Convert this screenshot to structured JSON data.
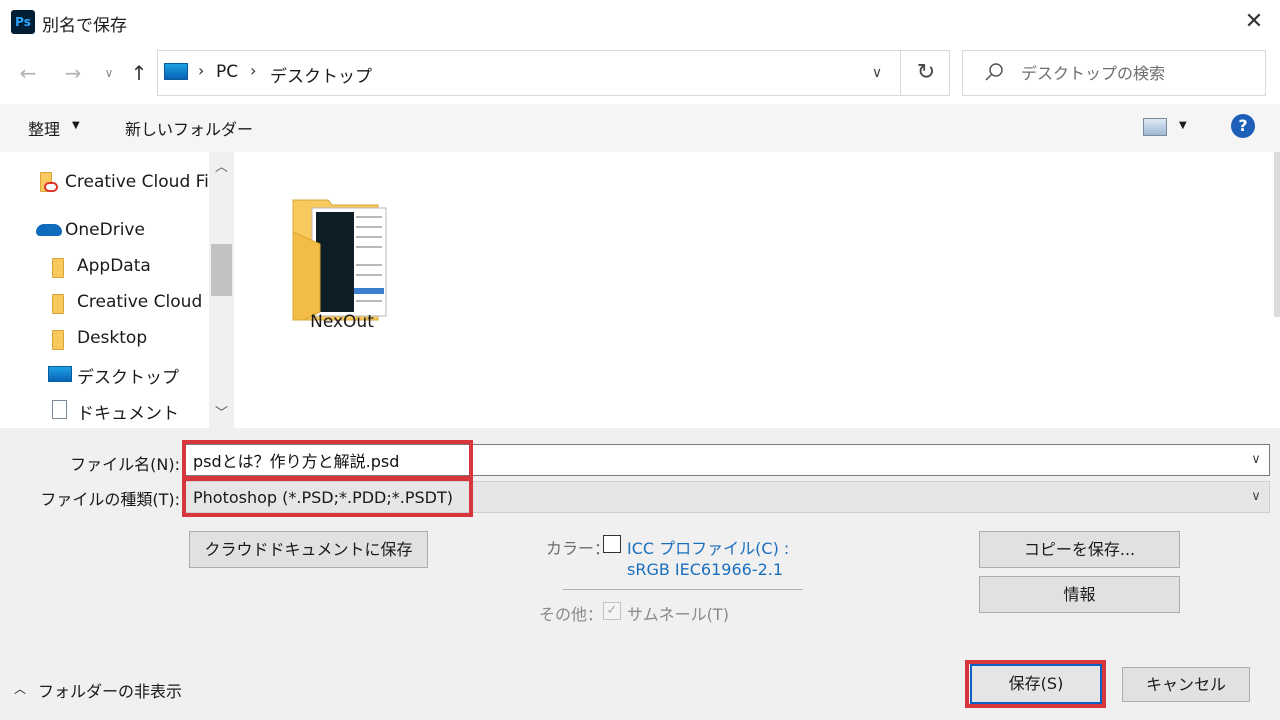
{
  "window": {
    "title": "別名で保存",
    "app_icon_text": "Ps"
  },
  "nav": {
    "back": "←",
    "forward": "→",
    "recent": "∨",
    "up": "↑",
    "breadcrumb": [
      "PC",
      "デスクトップ"
    ],
    "search_placeholder": "デスクトップの検索"
  },
  "toolbar": {
    "organize": "整理",
    "new_folder": "新しいフォルダー"
  },
  "sidebar": {
    "items": [
      {
        "label": "Creative Cloud Files",
        "icon": "creative-cloud-folder-icon"
      },
      {
        "label": "OneDrive",
        "icon": "onedrive-icon"
      },
      {
        "label": "AppData",
        "icon": "folder-icon"
      },
      {
        "label": "Creative Cloud Files",
        "icon": "folder-icon"
      },
      {
        "label": "Desktop",
        "icon": "folder-icon"
      },
      {
        "label": "デスクトップ",
        "icon": "desktop-icon"
      },
      {
        "label": "ドキュメント",
        "icon": "documents-icon"
      }
    ]
  },
  "content": {
    "items": [
      {
        "label": "NexOut",
        "icon": "folder-with-preview-icon"
      }
    ]
  },
  "form": {
    "filename_label": "ファイル名(N):",
    "filename_value": "psdとは？作り方と解説.psd",
    "filetype_label": "ファイルの種類(T):",
    "filetype_value": "Photoshop (*.PSD;*.PDD;*.PSDT)"
  },
  "options": {
    "cloud_save": "クラウドドキュメントに保存",
    "color_label": "カラー：",
    "icc_profile": "ICC プロファイル(C) :",
    "icc_value": "sRGB IEC61966-2.1",
    "other_label": "その他：",
    "thumbnail": "サムネール(T)",
    "save_copy": "コピーを保存...",
    "info": "情報"
  },
  "footer": {
    "hide_folders": "フォルダーの非表示",
    "save": "保存(S)",
    "cancel": "キャンセル"
  },
  "colors": {
    "highlight": "#d6363c",
    "link": "#1a6fbd",
    "accent": "#0b62c4"
  }
}
